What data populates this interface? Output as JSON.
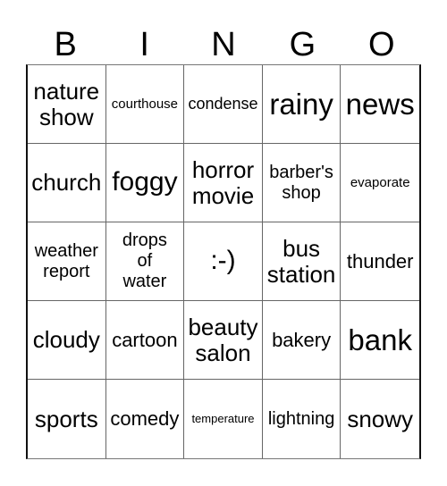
{
  "header": {
    "letters": [
      "B",
      "I",
      "N",
      "G",
      "O"
    ]
  },
  "board": {
    "cells": [
      "nature\nshow",
      "courthouse",
      "condense",
      "rainy",
      "news",
      "church",
      "foggy",
      "horror\nmovie",
      "barber's\nshop",
      "evaporate",
      "weather\nreport",
      "drops\nof\nwater",
      ":-)",
      "bus\nstation",
      "thunder",
      "cloudy",
      "cartoon",
      "beauty\nsalon",
      "bakery",
      "bank",
      "sports",
      "comedy",
      "temperature",
      "lightning",
      "snowy"
    ]
  }
}
